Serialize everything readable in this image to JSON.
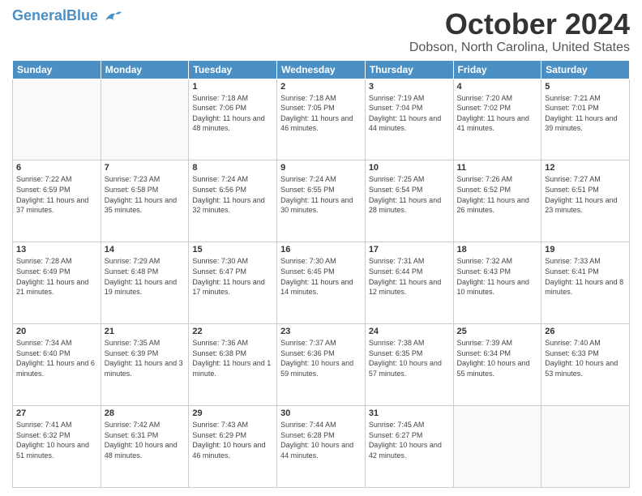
{
  "header": {
    "logo_general": "General",
    "logo_blue": "Blue",
    "month_title": "October 2024",
    "location": "Dobson, North Carolina, United States"
  },
  "days_of_week": [
    "Sunday",
    "Monday",
    "Tuesday",
    "Wednesday",
    "Thursday",
    "Friday",
    "Saturday"
  ],
  "weeks": [
    [
      {
        "day": "",
        "info": ""
      },
      {
        "day": "",
        "info": ""
      },
      {
        "day": "1",
        "info": "Sunrise: 7:18 AM\nSunset: 7:06 PM\nDaylight: 11 hours and 48 minutes."
      },
      {
        "day": "2",
        "info": "Sunrise: 7:18 AM\nSunset: 7:05 PM\nDaylight: 11 hours and 46 minutes."
      },
      {
        "day": "3",
        "info": "Sunrise: 7:19 AM\nSunset: 7:04 PM\nDaylight: 11 hours and 44 minutes."
      },
      {
        "day": "4",
        "info": "Sunrise: 7:20 AM\nSunset: 7:02 PM\nDaylight: 11 hours and 41 minutes."
      },
      {
        "day": "5",
        "info": "Sunrise: 7:21 AM\nSunset: 7:01 PM\nDaylight: 11 hours and 39 minutes."
      }
    ],
    [
      {
        "day": "6",
        "info": "Sunrise: 7:22 AM\nSunset: 6:59 PM\nDaylight: 11 hours and 37 minutes."
      },
      {
        "day": "7",
        "info": "Sunrise: 7:23 AM\nSunset: 6:58 PM\nDaylight: 11 hours and 35 minutes."
      },
      {
        "day": "8",
        "info": "Sunrise: 7:24 AM\nSunset: 6:56 PM\nDaylight: 11 hours and 32 minutes."
      },
      {
        "day": "9",
        "info": "Sunrise: 7:24 AM\nSunset: 6:55 PM\nDaylight: 11 hours and 30 minutes."
      },
      {
        "day": "10",
        "info": "Sunrise: 7:25 AM\nSunset: 6:54 PM\nDaylight: 11 hours and 28 minutes."
      },
      {
        "day": "11",
        "info": "Sunrise: 7:26 AM\nSunset: 6:52 PM\nDaylight: 11 hours and 26 minutes."
      },
      {
        "day": "12",
        "info": "Sunrise: 7:27 AM\nSunset: 6:51 PM\nDaylight: 11 hours and 23 minutes."
      }
    ],
    [
      {
        "day": "13",
        "info": "Sunrise: 7:28 AM\nSunset: 6:49 PM\nDaylight: 11 hours and 21 minutes."
      },
      {
        "day": "14",
        "info": "Sunrise: 7:29 AM\nSunset: 6:48 PM\nDaylight: 11 hours and 19 minutes."
      },
      {
        "day": "15",
        "info": "Sunrise: 7:30 AM\nSunset: 6:47 PM\nDaylight: 11 hours and 17 minutes."
      },
      {
        "day": "16",
        "info": "Sunrise: 7:30 AM\nSunset: 6:45 PM\nDaylight: 11 hours and 14 minutes."
      },
      {
        "day": "17",
        "info": "Sunrise: 7:31 AM\nSunset: 6:44 PM\nDaylight: 11 hours and 12 minutes."
      },
      {
        "day": "18",
        "info": "Sunrise: 7:32 AM\nSunset: 6:43 PM\nDaylight: 11 hours and 10 minutes."
      },
      {
        "day": "19",
        "info": "Sunrise: 7:33 AM\nSunset: 6:41 PM\nDaylight: 11 hours and 8 minutes."
      }
    ],
    [
      {
        "day": "20",
        "info": "Sunrise: 7:34 AM\nSunset: 6:40 PM\nDaylight: 11 hours and 6 minutes."
      },
      {
        "day": "21",
        "info": "Sunrise: 7:35 AM\nSunset: 6:39 PM\nDaylight: 11 hours and 3 minutes."
      },
      {
        "day": "22",
        "info": "Sunrise: 7:36 AM\nSunset: 6:38 PM\nDaylight: 11 hours and 1 minute."
      },
      {
        "day": "23",
        "info": "Sunrise: 7:37 AM\nSunset: 6:36 PM\nDaylight: 10 hours and 59 minutes."
      },
      {
        "day": "24",
        "info": "Sunrise: 7:38 AM\nSunset: 6:35 PM\nDaylight: 10 hours and 57 minutes."
      },
      {
        "day": "25",
        "info": "Sunrise: 7:39 AM\nSunset: 6:34 PM\nDaylight: 10 hours and 55 minutes."
      },
      {
        "day": "26",
        "info": "Sunrise: 7:40 AM\nSunset: 6:33 PM\nDaylight: 10 hours and 53 minutes."
      }
    ],
    [
      {
        "day": "27",
        "info": "Sunrise: 7:41 AM\nSunset: 6:32 PM\nDaylight: 10 hours and 51 minutes."
      },
      {
        "day": "28",
        "info": "Sunrise: 7:42 AM\nSunset: 6:31 PM\nDaylight: 10 hours and 48 minutes."
      },
      {
        "day": "29",
        "info": "Sunrise: 7:43 AM\nSunset: 6:29 PM\nDaylight: 10 hours and 46 minutes."
      },
      {
        "day": "30",
        "info": "Sunrise: 7:44 AM\nSunset: 6:28 PM\nDaylight: 10 hours and 44 minutes."
      },
      {
        "day": "31",
        "info": "Sunrise: 7:45 AM\nSunset: 6:27 PM\nDaylight: 10 hours and 42 minutes."
      },
      {
        "day": "",
        "info": ""
      },
      {
        "day": "",
        "info": ""
      }
    ]
  ]
}
